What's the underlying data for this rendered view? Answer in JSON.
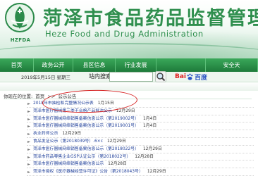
{
  "header": {
    "logo_text": "HZFDA",
    "title": "菏泽市食品药品监督管理局",
    "subtitle": "Heze Food and Drug Administration"
  },
  "nav": [
    {
      "label": "首页",
      "width": 48
    },
    {
      "label": "政务公开",
      "width": 56
    },
    {
      "label": "县区信息",
      "width": 60
    },
    {
      "label": "行业发展",
      "width": 58
    },
    {
      "label": "",
      "width": 70
    },
    {
      "label": "安全天",
      "width": 74
    }
  ],
  "infobar": {
    "date": "2019年5月15日 星期三",
    "search_label": "站内搜索:",
    "search_value": "",
    "baidu_bai": "Bai",
    "baidu_rest": "百度"
  },
  "breadcrumb": {
    "prefix": "你现在的位置:",
    "home": "首页",
    "sep": ">>",
    "current": "公示公告"
  },
  "list": [
    {
      "title": "2018年市抽检和完整情况公示表",
      "date": "1月15日"
    },
    {
      "title": "菏泽市医疗器械第三类不合格产品批次公示",
      "date": "12月29日"
    },
    {
      "title": "菏泽市医疗器械网络销售备案信息公示（第2019002号）",
      "date": "1月4日"
    },
    {
      "title": "菏泽市医疗器械网络销售备案信息公示（第2019001号）",
      "date": "1月4日"
    },
    {
      "title": "执业药师公示",
      "date": "12月29日"
    },
    {
      "title": "食品发证公示（第2018039号）.6×c",
      "date": "12月29日"
    },
    {
      "title": "菏泽市医疗器械网络销售备案信息公示（第2018022号）",
      "date": "12月29日"
    },
    {
      "title": "菏泽市药品零售企业GSP认证公示（第2018022号）",
      "date": "12月28日"
    },
    {
      "title": "菏泽市医疗器械网络销售备案信息公示",
      "date": "12月28日"
    },
    {
      "title": "菏泽市授权《医疗器械经营许可证》公告（第2018043号）",
      "date": "12月29日"
    }
  ],
  "colors": {
    "brand_green": "#2f8f4e",
    "nav_green": "#1e7a3a",
    "link_blue": "#1f3f99",
    "highlight_red": "#d62020"
  },
  "icons": {
    "logo": "hzfda-emblem-icon",
    "search": "magnifier-icon",
    "baidu": "baidu-paw-icon",
    "bullet": "arrow-bullet-icon"
  }
}
